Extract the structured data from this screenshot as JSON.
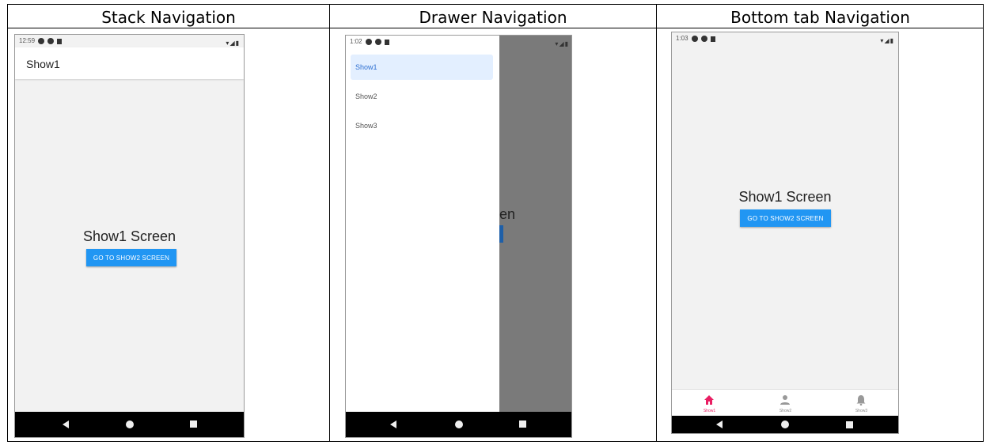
{
  "columns": [
    {
      "title": "Stack Navigation"
    },
    {
      "title": "Drawer Navigation"
    },
    {
      "title": "Bottom tab Navigation"
    }
  ],
  "stack": {
    "time": "12:59",
    "appbar_title": "Show1",
    "screen_title": "Show1 Screen",
    "button_label": "GO TO SHOW2 SCREEN"
  },
  "drawer": {
    "time": "1:02",
    "items": [
      "Show1",
      "Show2",
      "Show3"
    ],
    "active_item": "Show1",
    "partial_text": "en"
  },
  "tabs": {
    "time": "1:03",
    "screen_title": "Show1 Screen",
    "button_label": "GO TO SHOW2 SCREEN",
    "items": [
      {
        "label": "Show1",
        "icon": "home-icon",
        "active": true
      },
      {
        "label": "Show2",
        "icon": "person-icon",
        "active": false
      },
      {
        "label": "Show3",
        "icon": "bell-icon",
        "active": false
      }
    ]
  },
  "colors": {
    "accent_blue": "#2196f3",
    "active_tab": "#e91e63",
    "drawer_active_bg": "#e3efff",
    "nav_bar": "#000000",
    "screen_bg": "#f2f2f2"
  }
}
